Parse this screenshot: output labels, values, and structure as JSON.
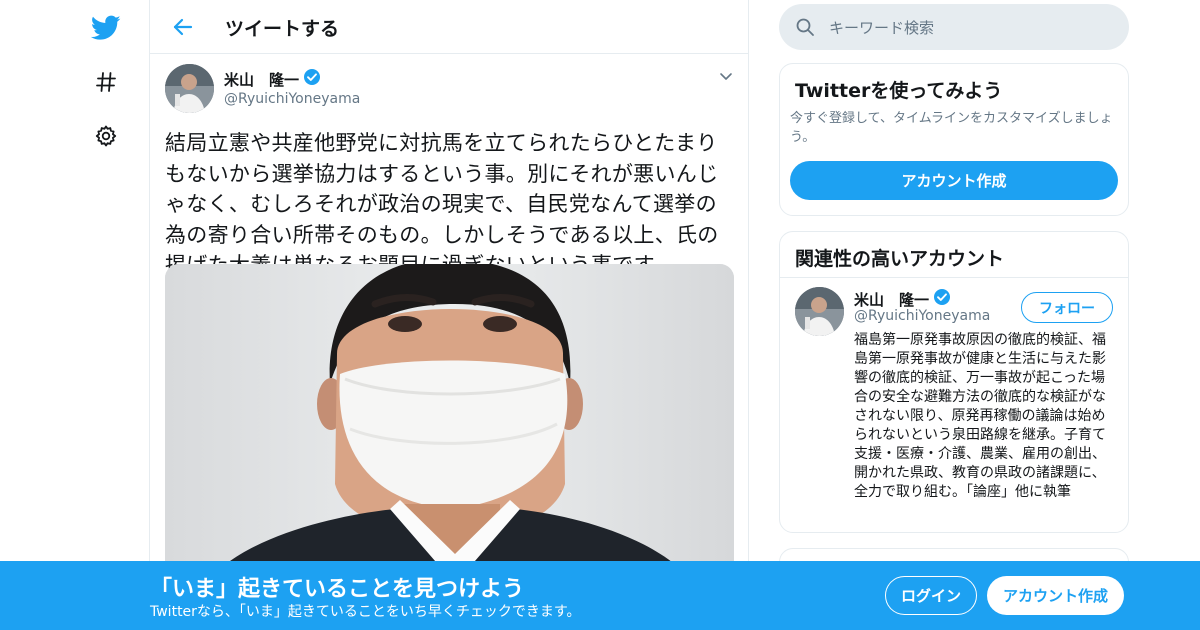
{
  "colors": {
    "accent": "#1da1f2",
    "text": "#14171a",
    "muted": "#657786",
    "border": "#e6ecf0"
  },
  "nav": {
    "icons": [
      "twitter-logo-icon",
      "hashtag-icon",
      "gear-icon"
    ]
  },
  "header": {
    "title": "ツイートする"
  },
  "tweet": {
    "author_name": "米山　隆一",
    "author_handle": "@RyuichiYoneyama",
    "verified": true,
    "text": "結局立憲や共産他野党に対抗馬を立てられたらひとたまりもないから選挙協力はするという事。別にそれが悪いんじゃなく、むしろそれが政治の現実で、自民党なんて選挙の為の寄り合い所帯そのもの。しかしそうである以上、氏の掲げた大義は単なるお題目に過ぎないという事です。"
  },
  "search": {
    "placeholder": "キーワード検索"
  },
  "signup_card": {
    "title": "Twitterを使ってみよう",
    "description": "今すぐ登録して、タイムラインをカスタマイズしましょう。",
    "button": "アカウント作成"
  },
  "related_card": {
    "title": "関連性の高いアカウント",
    "account": {
      "name": "米山　隆一",
      "handle": "@RyuichiYoneyama",
      "verified": true,
      "follow_label": "フォロー",
      "bio": "福島第一原発事故原因の徹底的検証、福島第一原発事故が健康と生活に与えた影響の徹底的検証、万一事故が起こった場合の安全な避難方法の徹底的な検証がなされない限り、原発再稼働の議論は始められないという泉田路線を継承。子育て支援・医療・介護、農業、雇用の創出、開かれた県政、教育の県政の諸課題に、全力で取り組む。「論座」他に執筆"
    }
  },
  "banner": {
    "title": "「いま」起きていることを見つけよう",
    "subtitle": "Twitterなら、「いま」起きていることをいち早くチェックできます。",
    "login": "ログイン",
    "signup": "アカウント作成"
  }
}
